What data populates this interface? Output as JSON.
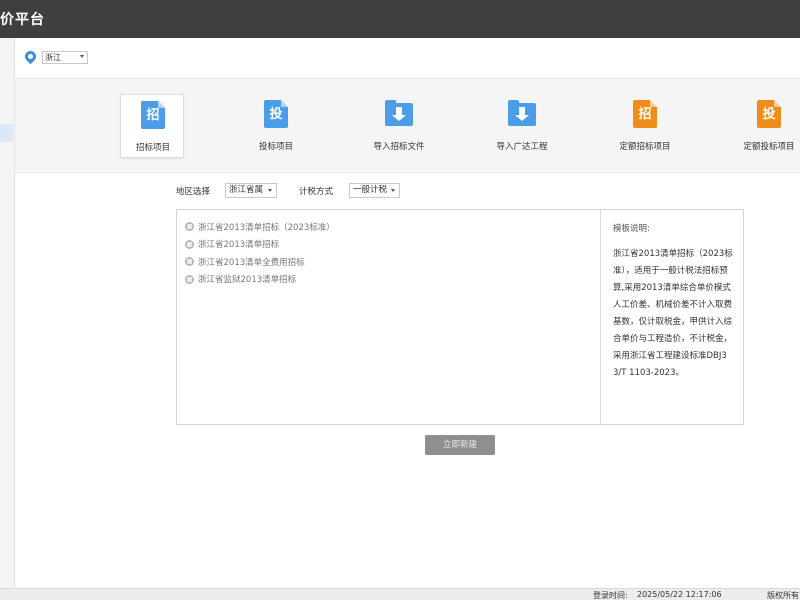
{
  "app": {
    "title": "价平台"
  },
  "region_bar": {
    "selected": "浙江"
  },
  "tiles": [
    {
      "label": "招标项目",
      "char": "招",
      "kind": "doc",
      "color": "#4a9de6",
      "active": true
    },
    {
      "label": "投标项目",
      "char": "投",
      "kind": "doc",
      "color": "#4a9de6",
      "active": false
    },
    {
      "label": "导入招标文件",
      "char": "",
      "kind": "folder",
      "color": "#4a9de6",
      "active": false
    },
    {
      "label": "导入广达工程",
      "char": "",
      "kind": "folder",
      "color": "#4a9de6",
      "active": false
    },
    {
      "label": "定额招标项目",
      "char": "招",
      "kind": "doc",
      "color": "#f08c1a",
      "active": false
    },
    {
      "label": "定额投标项目",
      "char": "投",
      "kind": "doc",
      "color": "#f08c1a",
      "active": false
    }
  ],
  "filters": {
    "region_label": "地区选择",
    "region_value": "浙江省属",
    "tax_label": "计税方式",
    "tax_value": "一般计税"
  },
  "templates": [
    "浙江省2013清单招标（2023标准）",
    "浙江省2013清单招标",
    "浙江省2013清单全费用招标",
    "浙江省监狱2013清单招标"
  ],
  "description": {
    "title": "模板说明:",
    "text": "浙江省2013清单招标（2023标准），适用于一般计税法招标预算,采用2013清单综合单价模式人工价差、机械价差不计入取费基数，仅计取税金，甲供计入综合单价与工程造价，不计税金，采用浙江省工程建设标准DBJ33/T 1103-2023。"
  },
  "create_button": "立即新建",
  "status": {
    "login_label": "登录时间:",
    "login_time": "2025/05/22 12:17:06",
    "copyright": "版权所有"
  }
}
